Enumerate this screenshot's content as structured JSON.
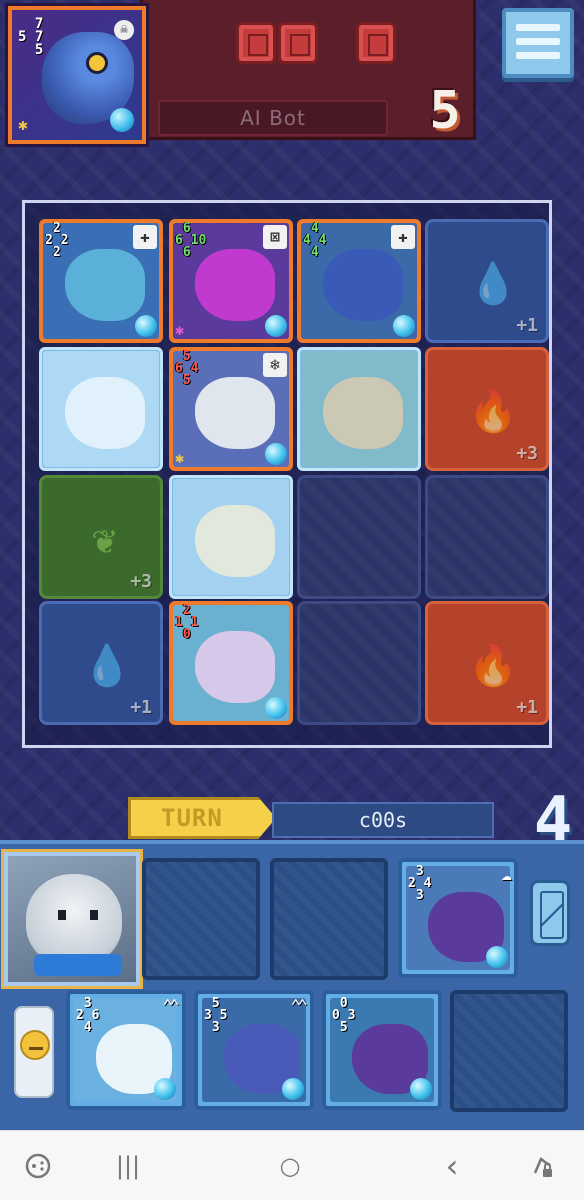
{
  "opponent": {
    "name": "AI Bot",
    "score": "5",
    "avatar_stats": "  7\n5 7\n  5"
  },
  "menu": {
    "icon": "hamburger-icon"
  },
  "board": {
    "cells": [
      {
        "kind": "card",
        "frame": "orange",
        "stats": " 2\n2 2\n 2",
        "badge": "✚",
        "body": "#5ab0d8",
        "art": "#3a6fb5"
      },
      {
        "kind": "card",
        "frame": "orange",
        "stats": " 6\n6 10\n 6",
        "stats_color": "green",
        "badge": "⊠",
        "body": "#c03ad0",
        "art": "#5a3a9a",
        "star": "pink"
      },
      {
        "kind": "card",
        "frame": "orange",
        "stats": " 4\n4 4\n 4",
        "stats_color": "green",
        "badge": "✚",
        "body": "#3a5ab8",
        "art": "#3c6aa8"
      },
      {
        "kind": "tile",
        "element": "water",
        "icon": "💧",
        "bonus": "+1"
      },
      {
        "kind": "card",
        "frame": "blue",
        "stats": "",
        "frozen": true,
        "body": "#eef4fa",
        "art": "#9fd0ee"
      },
      {
        "kind": "card",
        "frame": "orange",
        "stats": " 5\n6 4\n 5",
        "stats_color": "red",
        "badge": "❄",
        "body": "#dfe6ee",
        "art": "#5a6fb8",
        "star": "gold"
      },
      {
        "kind": "card",
        "frame": "blue",
        "stats": "",
        "frozen": true,
        "body": "#cdb58a",
        "art": "#5aa0b0"
      },
      {
        "kind": "tile",
        "element": "fire",
        "icon": "🔥",
        "bonus": "+3"
      },
      {
        "kind": "tile",
        "element": "leaf",
        "icon": "❦",
        "bonus": "+3"
      },
      {
        "kind": "card",
        "frame": "blue",
        "stats": "",
        "frozen": true,
        "body": "#f0e6c8",
        "art": "#8fc4e8"
      },
      {
        "kind": "empty"
      },
      {
        "kind": "empty"
      },
      {
        "kind": "tile",
        "element": "water",
        "icon": "💧",
        "bonus": "+1"
      },
      {
        "kind": "card",
        "frame": "orange",
        "stats": " 2\n1 1\n 0",
        "stats_color": "red",
        "body": "#d6c8e8",
        "art": "#6ab0d0"
      },
      {
        "kind": "empty"
      },
      {
        "kind": "tile",
        "element": "fire",
        "icon": "🔥",
        "bonus": "+1"
      }
    ]
  },
  "turn": {
    "label": "TURN",
    "player": "c00s",
    "count": "4"
  },
  "player": {
    "hero_name": "polar-bear",
    "field": [
      {
        "kind": "empty"
      },
      {
        "kind": "empty"
      },
      {
        "kind": "card",
        "stats": " 3\n2 4\n 3",
        "body": "#5a3a9a",
        "art": "#4a7ab8",
        "badge": "☁"
      }
    ],
    "hand": [
      {
        "kind": "card",
        "stats": " 3\n2 6\n 4",
        "body": "#eaf4fb",
        "art": "#6ab0e0",
        "chev": "⌃⌃"
      },
      {
        "kind": "card",
        "stats": " 5\n3 5\n 3",
        "body": "#4a5ab8",
        "art": "#3a6aa8",
        "chev": "⌃⌃"
      },
      {
        "kind": "card",
        "stats": " 0\n0 3\n 5",
        "body": "#5a3a9a",
        "art": "#3a7ab0",
        "chev": ""
      },
      {
        "kind": "empty"
      }
    ]
  },
  "colors": {
    "opponent_frame": "#ee7a2c",
    "player_frame": "#5aa2db",
    "turn_badge": "#f5d14a",
    "background": "#2c2f6b"
  },
  "system_nav": {
    "game_icon": "gamepad-icon",
    "recents": "|||",
    "home": "○",
    "back": "‹",
    "rotate_icon": "rotate-lock-icon"
  }
}
